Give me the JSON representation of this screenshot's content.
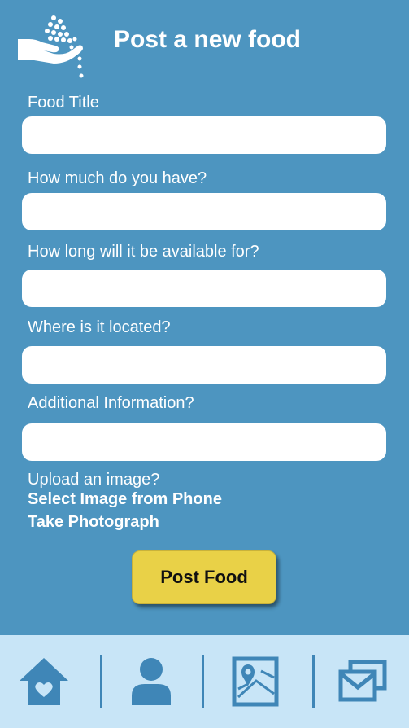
{
  "header": {
    "title": "Post a new food",
    "logo_icon": "hand-with-falling-seeds-icon"
  },
  "form": {
    "fields": [
      {
        "label": "Food Title",
        "value": "",
        "placeholder": ""
      },
      {
        "label": "How much do you have?",
        "value": "",
        "placeholder": ""
      },
      {
        "label": "How long will it be available for?",
        "value": "",
        "placeholder": ""
      },
      {
        "label": "Where is it located?",
        "value": "",
        "placeholder": ""
      },
      {
        "label": "Additional Information?",
        "value": "",
        "placeholder": ""
      }
    ],
    "upload_label": "Upload an image?",
    "select_image_label": "Select Image from Phone",
    "take_photo_label": "Take Photograph",
    "submit_label": "Post Food"
  },
  "tabbar": {
    "items": [
      {
        "icon": "home-heart-icon"
      },
      {
        "icon": "person-icon"
      },
      {
        "icon": "map-pin-icon"
      },
      {
        "icon": "messages-icon"
      }
    ]
  },
  "colors": {
    "background": "#4d95c0",
    "tabbar_background": "#c8e5f7",
    "icon_color": "#3f86b7",
    "button_color": "#e9d147",
    "text_color": "#ffffff"
  }
}
